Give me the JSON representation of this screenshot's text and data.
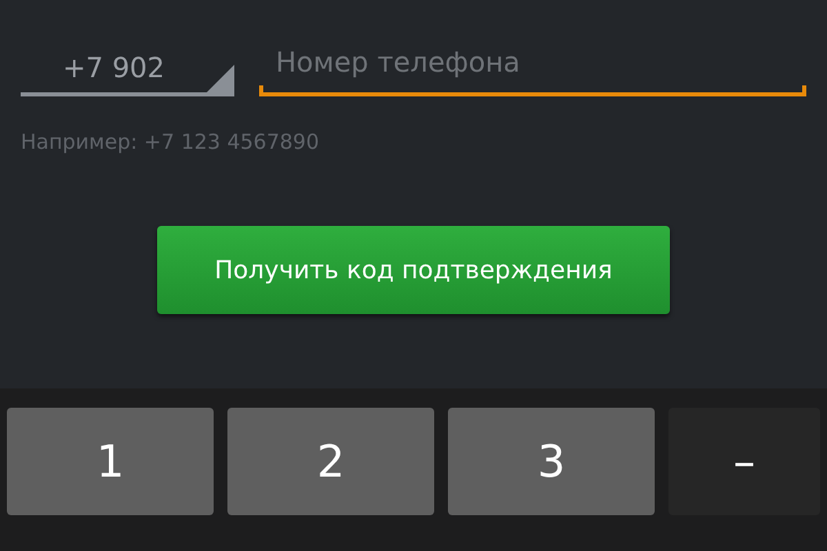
{
  "phone_form": {
    "country_code": "+7 902",
    "phone_placeholder": "Номер телефона",
    "hint": "Например: +7 123 4567890",
    "submit_button": "Получить код подтверждения"
  },
  "keyboard": {
    "keys": [
      {
        "label": "1",
        "kind": "digit"
      },
      {
        "label": "2",
        "kind": "digit"
      },
      {
        "label": "3",
        "kind": "digit"
      },
      {
        "label": "–",
        "kind": "symbol"
      }
    ]
  }
}
